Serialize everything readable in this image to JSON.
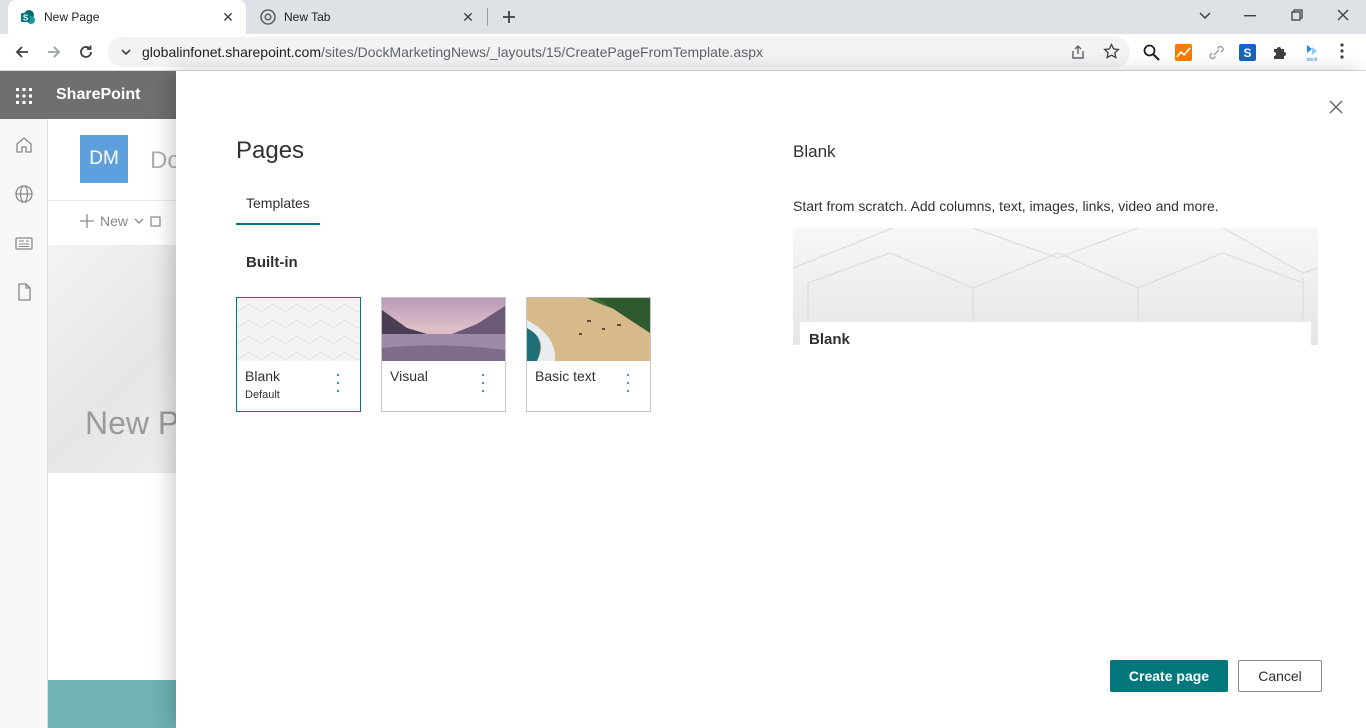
{
  "browser": {
    "tabs": [
      {
        "title": "New Page",
        "active": true,
        "favicon": "sharepoint-icon"
      },
      {
        "title": "New Tab",
        "active": false,
        "favicon": "chrome-icon"
      }
    ],
    "url_host": "globalinfonet.sharepoint.com",
    "url_path": "/sites/DockMarketingNews/_layouts/15/CreatePageFromTemplate.aspx"
  },
  "sharepoint": {
    "brand": "SharePoint",
    "site_logo_initials": "DM",
    "site_name": "Do",
    "new_command": "New",
    "hero_title": "New P"
  },
  "panel": {
    "title": "Pages",
    "tab_label": "Templates",
    "section_heading": "Built-in",
    "templates": [
      {
        "name": "Blank",
        "sub": "Default",
        "selected": true
      },
      {
        "name": "Visual",
        "sub": "",
        "selected": false
      },
      {
        "name": "Basic text",
        "sub": "",
        "selected": false
      }
    ],
    "preview": {
      "title": "Blank",
      "description": "Start from scratch. Add columns, text, images, links, video and more.",
      "card_label": "Blank"
    },
    "create_button": "Create page",
    "cancel_button": "Cancel"
  },
  "colors": {
    "accent": "#03787c",
    "suite_bar": "#6f6f6f",
    "site_logo": "#5ea0dd"
  }
}
